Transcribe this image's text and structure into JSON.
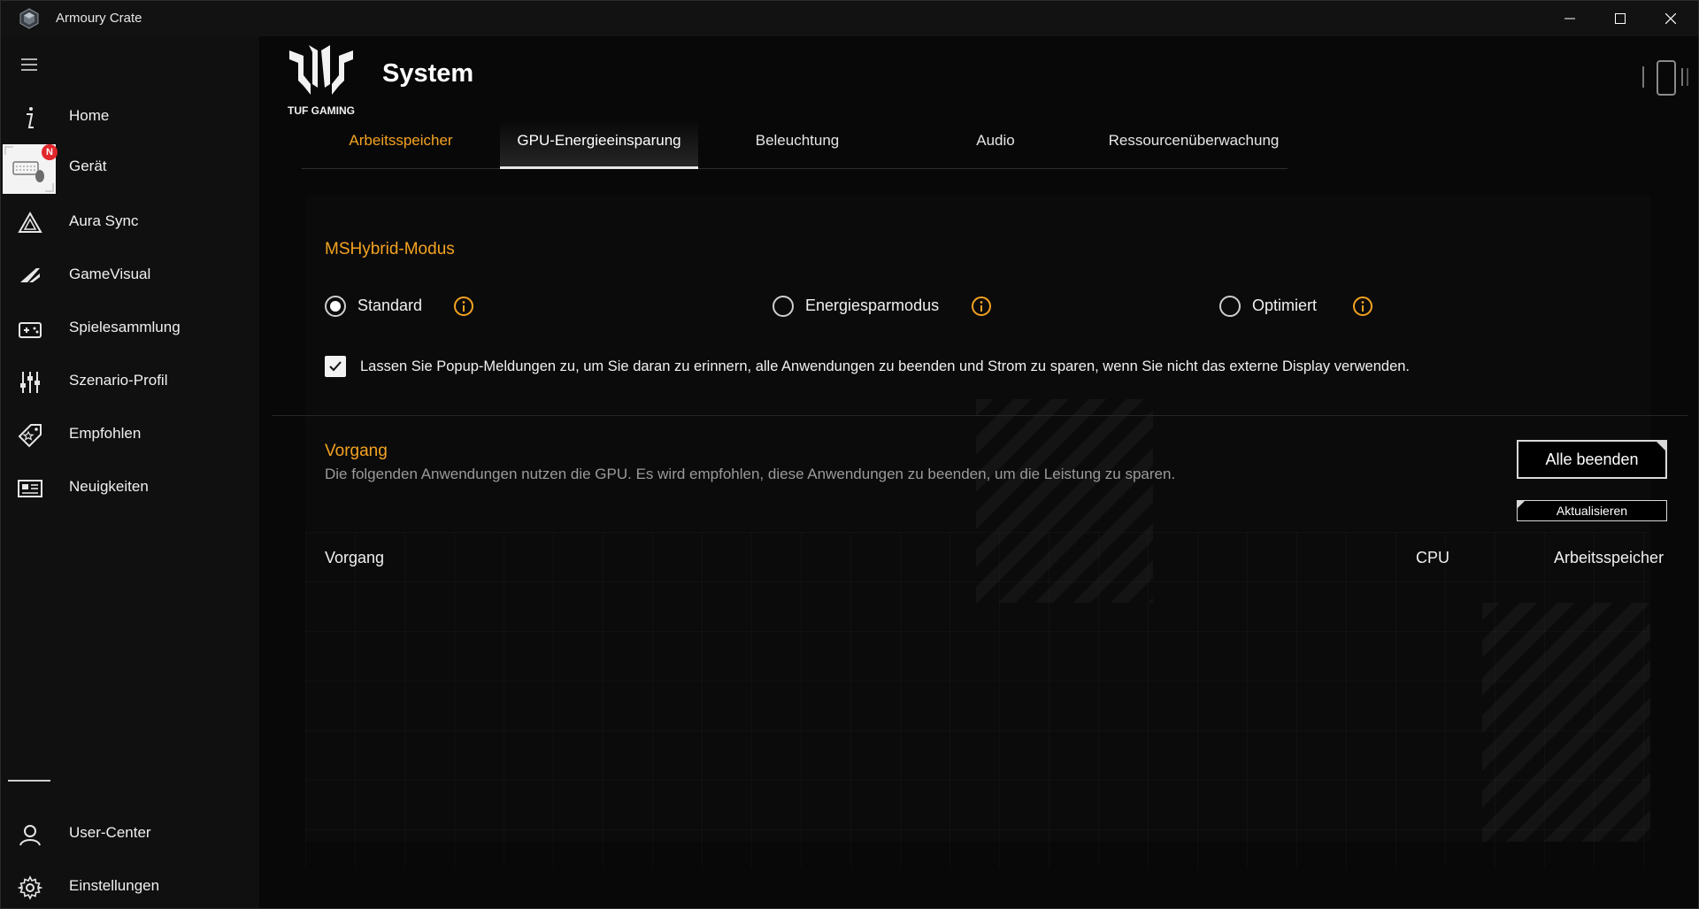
{
  "window": {
    "title": "Armoury Crate"
  },
  "sidebar": {
    "items": [
      {
        "label": "Home",
        "icon": "home-i-icon"
      },
      {
        "label": "Gerät",
        "icon": "keyboard-mouse-icon",
        "badge": "N"
      },
      {
        "label": "Aura Sync",
        "icon": "aura-triangle-icon"
      },
      {
        "label": "GameVisual",
        "icon": "gamevisual-icon"
      },
      {
        "label": "Spielesammlung",
        "icon": "game-library-icon"
      },
      {
        "label": "Szenario-Profil",
        "icon": "sliders-icon"
      },
      {
        "label": "Empfohlen",
        "icon": "tag-star-icon"
      },
      {
        "label": "Neuigkeiten",
        "icon": "newspaper-icon"
      }
    ],
    "bottom_items": [
      {
        "label": "User-Center",
        "icon": "user-icon"
      },
      {
        "label": "Einstellungen",
        "icon": "gear-icon"
      }
    ]
  },
  "header": {
    "brand": "TUF GAMING",
    "title": "System"
  },
  "tabs": [
    {
      "label": "Arbeitsspeicher",
      "state": "warm"
    },
    {
      "label": "GPU-Energieeinsparung",
      "state": "active"
    },
    {
      "label": "Beleuchtung",
      "state": "normal"
    },
    {
      "label": "Audio",
      "state": "normal"
    },
    {
      "label": "Ressourcenüberwachung",
      "state": "normal"
    }
  ],
  "mshybrid": {
    "title": "MSHybrid-Modus",
    "options": [
      {
        "label": "Standard",
        "selected": true
      },
      {
        "label": "Energiesparmodus",
        "selected": false
      },
      {
        "label": "Optimiert",
        "selected": false
      }
    ],
    "popup_checkbox": {
      "checked": true,
      "text": "Lassen Sie Popup-Meldungen zu, um Sie daran zu erinnern, alle Anwendungen zu beenden und Strom zu sparen, wenn Sie nicht das externe Display verwenden."
    }
  },
  "process": {
    "title": "Vorgang",
    "description": "Die folgenden Anwendungen nutzen die GPU. Es wird empfohlen, diese Anwendungen zu beenden, um die Leistung zu sparen.",
    "end_all_label": "Alle beenden",
    "refresh_label": "Aktualisieren",
    "columns": [
      "Vorgang",
      "CPU",
      "Arbeitsspeicher"
    ],
    "rows": []
  },
  "colors": {
    "accent": "#f4a321",
    "background": "#080808",
    "text": "#f0f0f0"
  }
}
